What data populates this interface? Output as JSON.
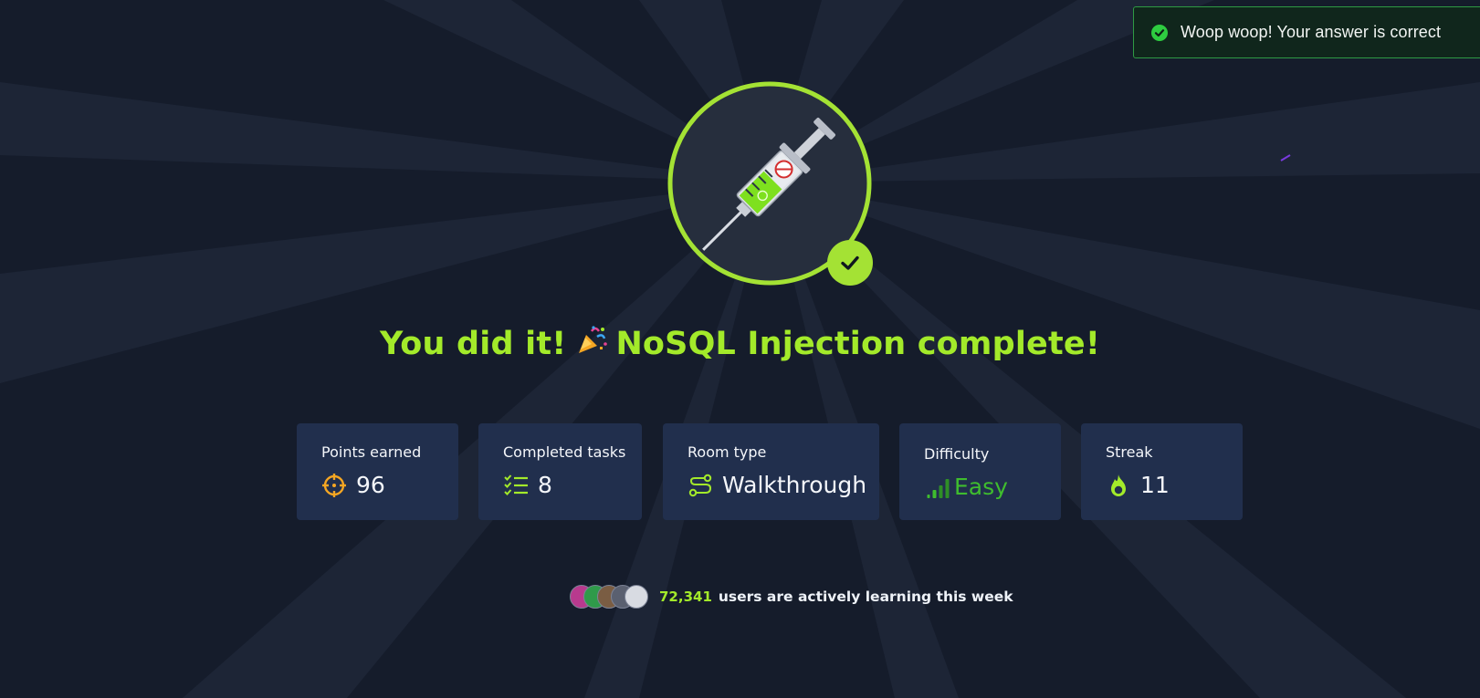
{
  "toast": {
    "message": "Woop woop! Your answer is correct",
    "icon": "check-circle-icon",
    "color": "#2ecc40"
  },
  "completion": {
    "title_prefix": "You did it!",
    "title_suffix": "NoSQL Injection complete!",
    "hero_icon": "syringe-icon",
    "badge_icon": "checkmark-icon",
    "accent_color": "#a3ea2a"
  },
  "stats": [
    {
      "label": "Points earned",
      "value": "96",
      "icon": "crosshair-icon",
      "icon_color": "#f5a623"
    },
    {
      "label": "Completed tasks",
      "value": "8",
      "icon": "checklist-icon",
      "icon_color": "#a3ea2a"
    },
    {
      "label": "Room type",
      "value": "Walkthrough",
      "icon": "route-icon",
      "icon_color": "#a3ea2a"
    },
    {
      "label": "Difficulty",
      "value": "Easy",
      "icon": "signal-bars-icon",
      "icon_color": "#3fbd2e"
    },
    {
      "label": "Streak",
      "value": "11",
      "icon": "flame-icon",
      "icon_color": "#a3ea2a"
    }
  ],
  "community": {
    "count": "72,341",
    "text": "users are actively learning this week",
    "avatar_count": 5
  }
}
